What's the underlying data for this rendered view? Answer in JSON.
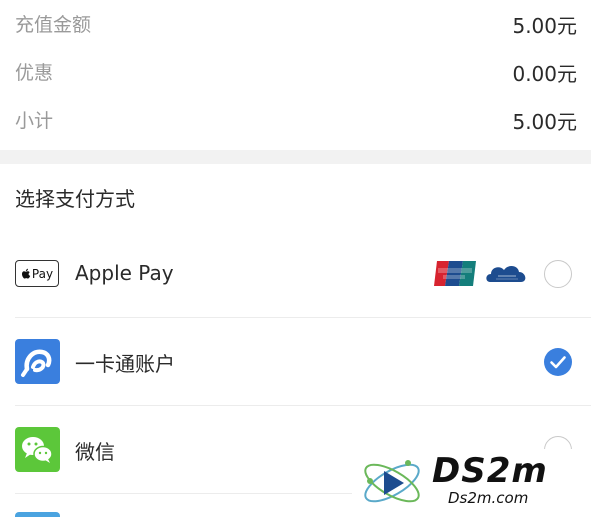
{
  "summary": {
    "rows": [
      {
        "label": "充值金额",
        "value": "5.00元"
      },
      {
        "label": "优惠",
        "value": "0.00元"
      },
      {
        "label": "小计",
        "value": "5.00元"
      }
    ]
  },
  "payment": {
    "section_title": "选择支付方式",
    "methods": [
      {
        "name": "Apple Pay",
        "badge_text": "Pay",
        "selected": false,
        "extra_logos": [
          "unionpay-icon",
          "quickpass-icon"
        ]
      },
      {
        "name": "一卡通账户",
        "selected": true
      },
      {
        "name": "微信",
        "selected": false
      }
    ]
  },
  "colors": {
    "accent": "#3a7fde",
    "wechat": "#5cc73a",
    "card_icon": "#3a7fde"
  },
  "watermark": {
    "big": "DS2m",
    "small": "Ds2m.com"
  }
}
